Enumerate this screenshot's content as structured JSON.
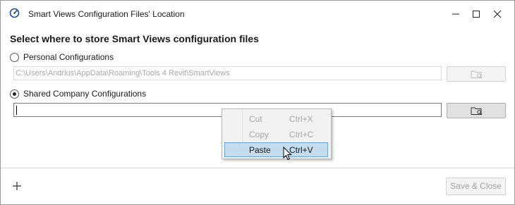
{
  "window": {
    "title": "Smart Views Configuration Files' Location",
    "icons": [
      "app-icon",
      "minimize-icon",
      "maximize-icon",
      "close-icon"
    ]
  },
  "heading": "Select where to store Smart Views configuration files",
  "personal": {
    "label": "Personal Configurations",
    "checked": false,
    "path": "C:\\Users\\Andrius\\AppData\\Roaming\\Tools 4 Revit\\SmartViews",
    "enabled": false,
    "browse_icon": "folder-search-icon"
  },
  "shared": {
    "label": "Shared Company Configurations",
    "checked": true,
    "path": "",
    "enabled": true,
    "browse_icon": "folder-search-icon"
  },
  "context_menu": {
    "items": [
      {
        "label": "Cut",
        "shortcut": "Ctrl+X",
        "enabled": false
      },
      {
        "label": "Copy",
        "shortcut": "Ctrl+C",
        "enabled": false
      },
      {
        "label": "Paste",
        "shortcut": "Ctrl+V",
        "enabled": true,
        "highlighted": true
      }
    ]
  },
  "footer": {
    "add_icon": "plus-icon",
    "save_label": "Save & Close",
    "save_enabled": false
  },
  "colors": {
    "highlight_bg": "#c5dcee",
    "highlight_border": "#6ea5d0",
    "disabled_text": "#a6a6a6"
  }
}
